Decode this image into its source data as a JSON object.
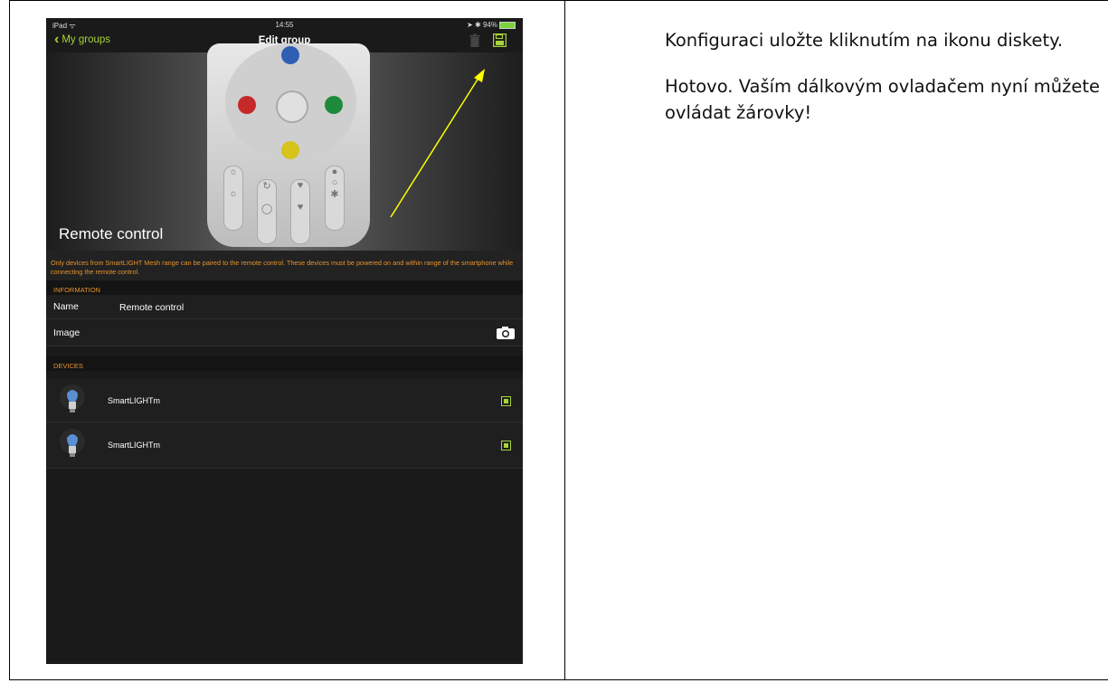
{
  "instructions": {
    "paragraph1": "Konfiguraci uložte kliknutím na ikonu diskety.",
    "paragraph2": "Hotovo. Vaším dálkovým ovladačem nyní můžete ovládat žárovky!"
  },
  "statusbar": {
    "left": "iPad ᯤ",
    "time": "14:55",
    "right": "➤ ✱ 94%"
  },
  "navbar": {
    "back_label": "My groups",
    "title": "Edit group"
  },
  "hero": {
    "label": "Remote control"
  },
  "warning": "Only devices from SmartLIGHT Mesh range can be paired to the remote control. These devices must be powered on and within range of the smartphone while connecting the remote control.",
  "information": {
    "header": "INFORMATION",
    "name_label": "Name",
    "name_value": "Remote control",
    "image_label": "Image"
  },
  "devices": {
    "header": "DEVICES",
    "items": [
      {
        "name": "SmartLIGHTm",
        "checked": true
      },
      {
        "name": "SmartLIGHTm",
        "checked": true
      }
    ]
  },
  "colors": {
    "accent_green": "#a6d33a",
    "warning_orange": "#e8932b",
    "arrow_yellow": "#ffff00"
  }
}
